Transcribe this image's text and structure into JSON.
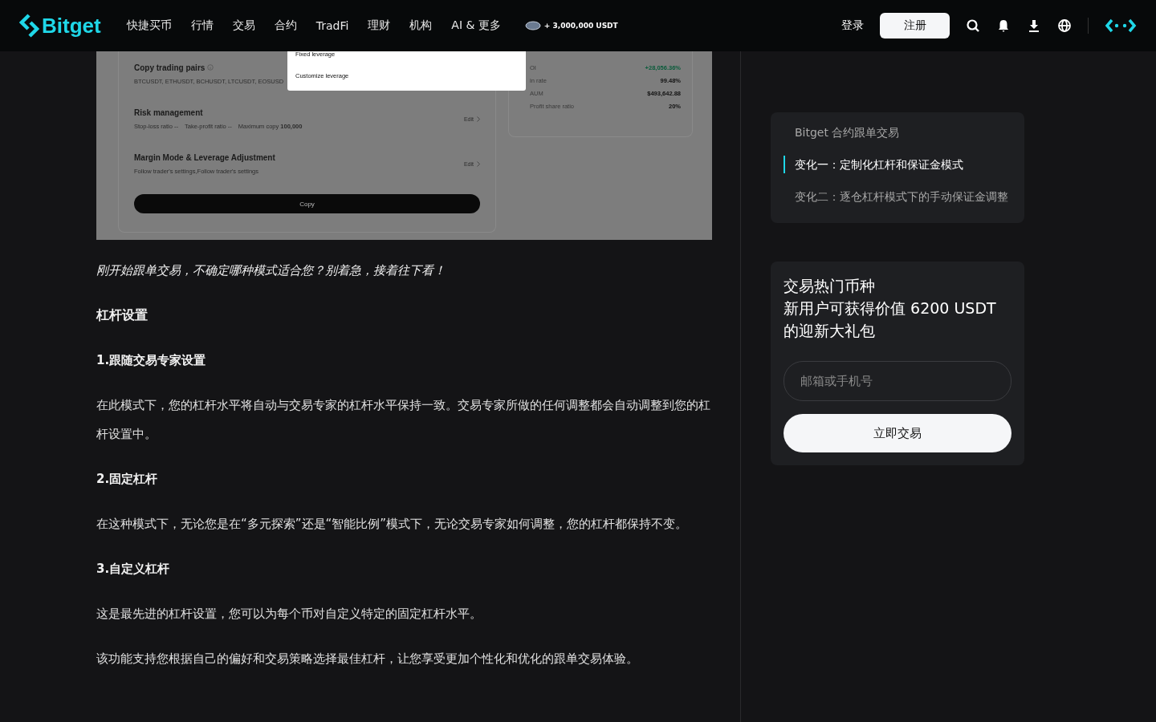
{
  "header": {
    "logo": "Bitget",
    "nav": [
      "快捷买币",
      "行情",
      "交易",
      "合约",
      "TradFi",
      "理财",
      "机构",
      "AI & 更多"
    ],
    "promo": "+ 3,000,000 USDT",
    "login": "登录",
    "register": "注册"
  },
  "screenshot": {
    "popup": [
      "Fixed leverage",
      "Customize leverage"
    ],
    "sections": [
      {
        "title": "Copy trading pairs",
        "info": true,
        "lines": [
          {
            "label": "BTCUSDT, ETHUSDT, BCHUSDT, LTCUSDT, EOSUSD"
          }
        ]
      },
      {
        "title": "Risk management",
        "edit": "Edit",
        "lines": [
          {
            "label": "Stop-loss ratio --"
          },
          {
            "label": "Take-profit ratio --"
          },
          {
            "label": "Maximum copy",
            "value": "100,000"
          }
        ]
      },
      {
        "title": "Margin Mode & Leverage Adjustment",
        "edit": "Edit",
        "lines": [
          {
            "label": "Follow trader's settings,Follow trader's settings"
          }
        ]
      }
    ],
    "copy_button": "Copy",
    "stats": [
      {
        "label": "OI",
        "value": "+28,056.36%",
        "positive": true
      },
      {
        "label": "in rate",
        "value": "99.48%",
        "positive": false
      },
      {
        "label": "AUM",
        "value": "$493,642.88",
        "positive": false
      },
      {
        "label": "Profit share ratio",
        "value": "20%",
        "positive": false
      }
    ]
  },
  "article": [
    {
      "kind": "italic",
      "text": "刚开始跟单交易，不确定哪种模式适合您？别着急，接着往下看！"
    },
    {
      "kind": "heading",
      "text": "杠杆设置"
    },
    {
      "kind": "subheading",
      "text": "1.跟随交易专家设置"
    },
    {
      "kind": "paragraph",
      "text": "在此模式下，您的杠杆水平将自动与交易专家的杠杆水平保持一致。交易专家所做的任何调整都会自动调整到您的杠杆设置中。"
    },
    {
      "kind": "subheading",
      "text": "2.固定杠杆"
    },
    {
      "kind": "paragraph",
      "text": "在这种模式下，无论您是在“多元探索”还是“智能比例”模式下，无论交易专家如何调整，您的杠杆都保持不变。"
    },
    {
      "kind": "subheading",
      "text": "3.自定义杠杆"
    },
    {
      "kind": "paragraph",
      "text": "这是最先进的杠杆设置，您可以为每个币对自定义特定的固定杠杆水平。"
    },
    {
      "kind": "paragraph",
      "text": "该功能支持您根据自己的偏好和交易策略选择最佳杠杆，让您享受更加个性化和优化的跟单交易体验。"
    }
  ],
  "toc": [
    {
      "label": "Bitget 合约跟单交易",
      "selected": false
    },
    {
      "label": "变化一：定制化杠杆和保证金模式",
      "selected": true
    },
    {
      "label": "变化二：逐仓杠杆模式下的手动保证金调整",
      "selected": false
    }
  ],
  "promo_card": {
    "title": [
      "交易热门币种",
      "新用户可获得价值 6200 USDT 的迎新大礼包"
    ],
    "placeholder": "邮箱或手机号",
    "button": "立即交易"
  }
}
